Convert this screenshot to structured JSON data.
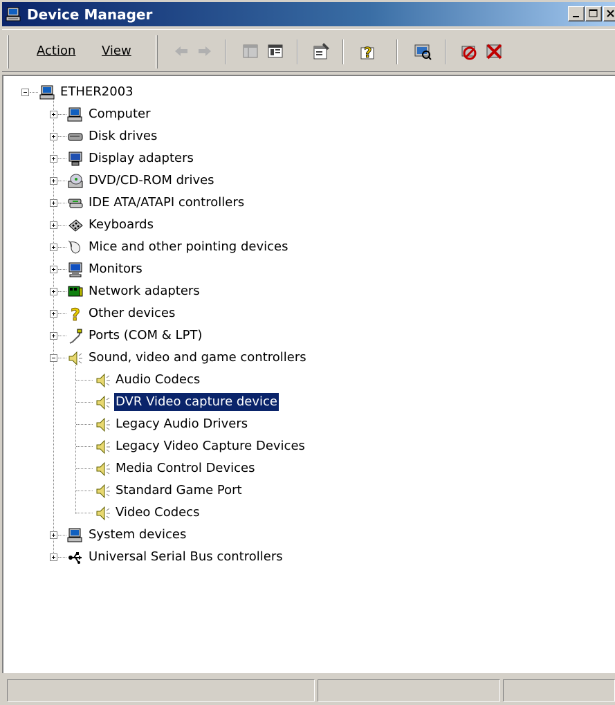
{
  "window": {
    "title": "Device Manager"
  },
  "menu": {
    "action": "Action",
    "view": "View"
  },
  "toolbar": {
    "icons": [
      "back-arrow-icon",
      "forward-arrow-icon",
      "show-hide-tree-icon",
      "console-tree-icon",
      "properties-icon",
      "help-icon",
      "scan-hardware-icon",
      "disable-device-icon",
      "uninstall-device-icon"
    ]
  },
  "tree": {
    "root": "ETHER2003",
    "categories": [
      {
        "label": "Computer",
        "icon": "computer-icon"
      },
      {
        "label": "Disk drives",
        "icon": "disk-drive-icon"
      },
      {
        "label": "Display adapters",
        "icon": "display-adapter-icon"
      },
      {
        "label": "DVD/CD-ROM drives",
        "icon": "cdrom-icon"
      },
      {
        "label": "IDE ATA/ATAPI controllers",
        "icon": "ide-controller-icon"
      },
      {
        "label": "Keyboards",
        "icon": "keyboard-icon"
      },
      {
        "label": "Mice and other pointing devices",
        "icon": "mouse-icon"
      },
      {
        "label": "Monitors",
        "icon": "monitor-icon"
      },
      {
        "label": "Network adapters",
        "icon": "network-adapter-icon"
      },
      {
        "label": "Other devices",
        "icon": "unknown-device-icon"
      },
      {
        "label": "Ports (COM & LPT)",
        "icon": "port-icon"
      },
      {
        "label": "Sound, video and game controllers",
        "icon": "speaker-icon"
      }
    ],
    "sound_children": [
      "Audio Codecs",
      "DVR Video capture device",
      "Legacy Audio Drivers",
      "Legacy Video Capture Devices",
      "Media Control Devices",
      "Standard Game Port",
      "Video Codecs"
    ],
    "selected": "DVR Video capture device",
    "after": [
      {
        "label": "System devices",
        "icon": "computer-icon"
      },
      {
        "label": "Universal Serial Bus controllers",
        "icon": "usb-icon"
      }
    ]
  },
  "colors": {
    "title_gradient_start": "#0a246a",
    "selection": "#0a246a",
    "face": "#d4d0c8"
  }
}
